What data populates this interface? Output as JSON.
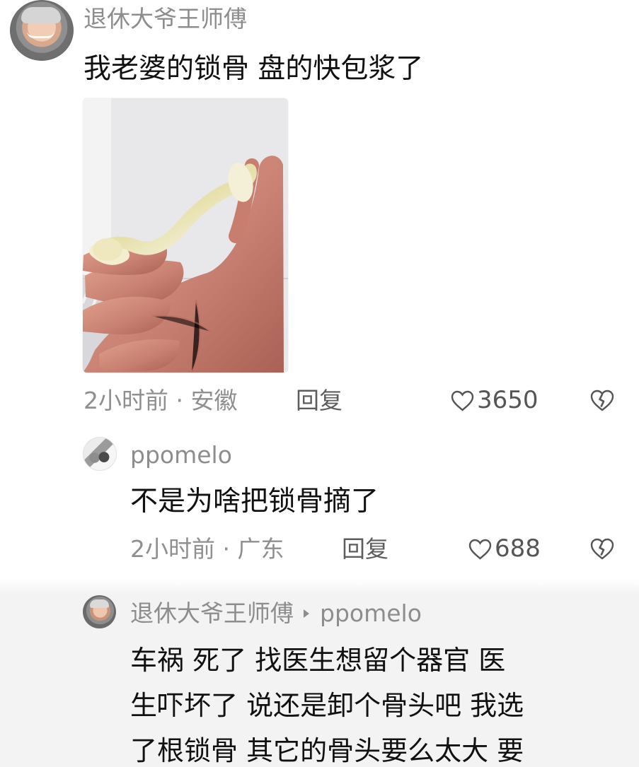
{
  "comments": [
    {
      "username": "退休大爷王师傅",
      "text": "我老婆的锁骨  盘的快包浆了",
      "time_location": "2小时前 · 安徽",
      "reply_label": "回复",
      "likes": "3650"
    },
    {
      "username": "ppomelo",
      "text": "不是为啥把锁骨摘了",
      "time_location": "2小时前 · 广东",
      "reply_label": "回复",
      "likes": "688"
    },
    {
      "username": "退休大爷王师傅",
      "reply_to": "ppomelo",
      "text_lines": [
        "车祸 死了  找医生想留个器官  医",
        "生吓坏了  说还是卸个骨头吧  我选",
        "了根锁骨  其它的骨头要么太大  要"
      ]
    }
  ],
  "icons": {
    "like": "heart-icon",
    "dislike": "broken-heart-icon",
    "reply_arrow": "chevron-right-icon"
  }
}
